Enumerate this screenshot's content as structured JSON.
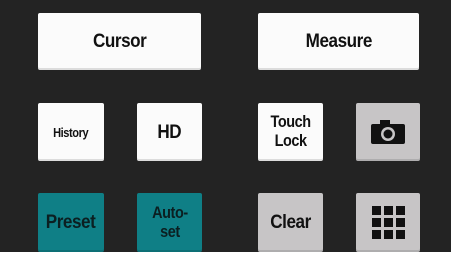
{
  "panel": {
    "buttons": {
      "cursor": "Cursor",
      "measure": "Measure",
      "history": "History",
      "hd": "HD",
      "touch_lock": "Touch\nLock",
      "preset": "Preset",
      "autoset": "Auto-\nset",
      "clear": "Clear"
    },
    "icons": {
      "camera": "camera-icon",
      "grid": "grid-icon"
    }
  },
  "colors": {
    "background": "#232323",
    "white_key": "#fbfbfb",
    "grey_key": "#c7c5c6",
    "teal_key": "#0f7f86"
  }
}
